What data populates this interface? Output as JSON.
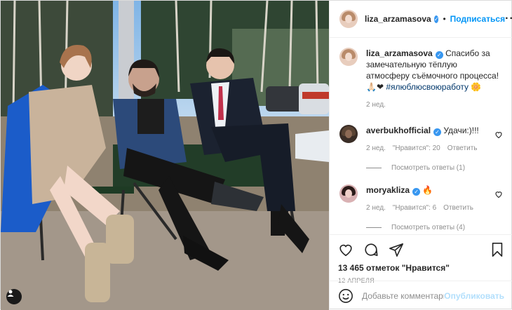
{
  "post": {
    "author": "liza_arzamasova",
    "follow_label": "Подписаться",
    "dot": "•",
    "more": "···"
  },
  "caption": {
    "username": "liza_arzamasova",
    "text": "Спасибо за замечательную тёплую атмосферу съёмочного процесса! 🙏🏻❤",
    "hashtag": "#ялюблюсвоюработу",
    "hashtag_emoji": "🌼",
    "time": "2 нед."
  },
  "comments": [
    {
      "username": "averbukhofficial",
      "text": "Удачи:)!!!",
      "time": "2 нед.",
      "likes": "\"Нравится\": 20",
      "reply_label": "Ответить",
      "view_replies": "Посмотреть ответы (1)"
    },
    {
      "username": "moryakliza",
      "text": "🔥",
      "time": "2 нед.",
      "likes": "\"Нравится\": 6",
      "reply_label": "Ответить",
      "view_replies": "Посмотреть ответы (4)"
    }
  ],
  "stats": {
    "likes": "13 465 отметок \"Нравится\"",
    "date": "12 АПРЕЛЯ"
  },
  "add_comment": {
    "placeholder": "Добавьте комментарий...",
    "publish": "Опубликовать"
  },
  "icons": [
    "heart-icon",
    "comment-icon",
    "share-icon",
    "bookmark-icon",
    "emoji-icon",
    "user-tag-icon",
    "more-options-icon",
    "verified-icon"
  ],
  "colors": {
    "accent": "#0095f6",
    "verified": "#3897f0",
    "muted": "#8e8e8e",
    "publish_disabled": "#b2dffc"
  }
}
